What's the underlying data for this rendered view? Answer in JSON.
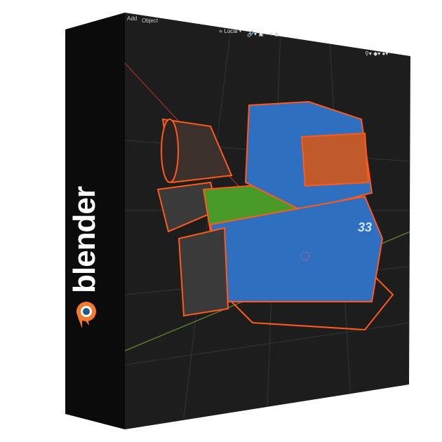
{
  "brand": {
    "name": "blender",
    "accent": "#f5792a"
  },
  "menu": {
    "add": "Add",
    "object": "Object"
  },
  "header": {
    "orientation": "Local"
  },
  "model": {
    "number": "33",
    "body_color": "#2f6fc0",
    "outline_color": "#ff5a1a"
  }
}
